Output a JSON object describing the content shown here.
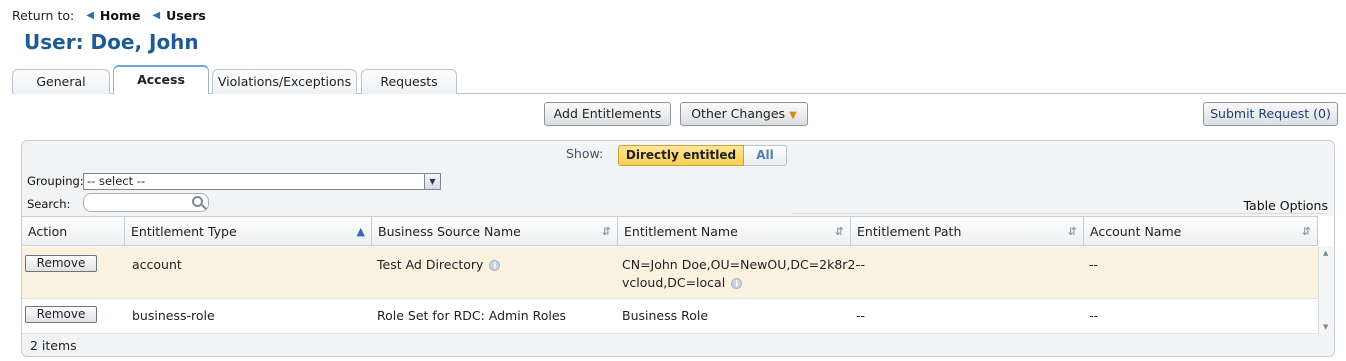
{
  "return_bar": {
    "label": "Return to:",
    "links": [
      "Home",
      "Users"
    ]
  },
  "page": {
    "title": "User: Doe, John"
  },
  "tabs": [
    {
      "label": "General"
    },
    {
      "label": "Access"
    },
    {
      "label": "Violations/Exceptions"
    },
    {
      "label": "Requests"
    }
  ],
  "toolbar": {
    "add_entitlements": "Add Entitlements",
    "other_changes": "Other Changes",
    "submit_request": "Submit Request (0)"
  },
  "filter": {
    "show_label": "Show:",
    "directly_entitled": "Directly entitled",
    "all": "All",
    "grouping_label": "Grouping:",
    "grouping_value": "-- select --",
    "search_label": "Search:",
    "search_value": "",
    "table_options": "Table Options"
  },
  "table": {
    "columns": [
      "Action",
      "Entitlement Type",
      "Business Source Name",
      "Entitlement Name",
      "Entitlement Path",
      "Account Name"
    ],
    "rows": [
      {
        "action": "Remove",
        "entitlement_type": "account",
        "business_source_name": "Test Ad Directory",
        "entitlement_name_line1": "CN=John Doe,OU=NewOU,DC=2k8r2-",
        "entitlement_name_line2": "vcloud,DC=local",
        "entitlement_path": "--",
        "account_name": "--"
      },
      {
        "action": "Remove",
        "entitlement_type": "business-role",
        "business_source_name": "Role Set for RDC: Admin Roles",
        "entitlement_name_line1": "Business Role",
        "entitlement_path": "--",
        "account_name": "--"
      }
    ],
    "footer": "2 items"
  },
  "colors": {
    "title": "#1f5a94",
    "toggle_active": "#f8cf55",
    "selected_row": "#faf1e1"
  }
}
